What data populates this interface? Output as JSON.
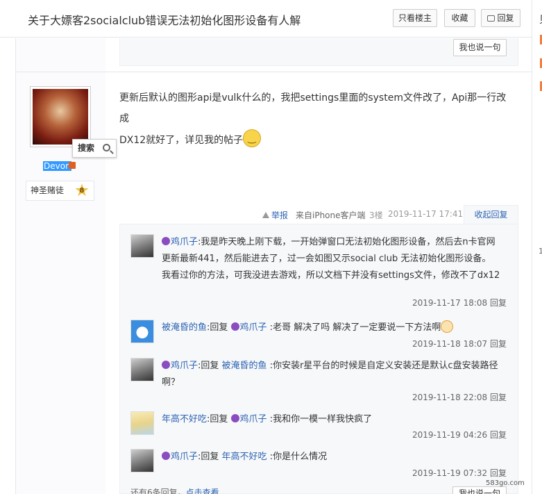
{
  "header": {
    "title": "关于大嫖客2socialclub错误无法初始化图形设备有人解",
    "only_op": "只看楼主",
    "favorite": "收藏",
    "reply": "回复"
  },
  "right_strip": {
    "char": "贝",
    "number": "1",
    "accent": "#f47c3c"
  },
  "previous_post": {
    "say_button": "我也说一句"
  },
  "user": {
    "name": "Devon",
    "rank_title": "神圣赌徒",
    "level": "8",
    "search_tooltip": "搜索"
  },
  "post": {
    "text_line1": "更新后默认的图形api是vulk什么的，我把settings里面的system文件改了，Api那一行改成",
    "text_line2": "DX12就好了，详见我的帖子",
    "report": "举报",
    "client": "来自iPhone客户端",
    "floor": "3楼",
    "time": "2019-11-17 17:41",
    "collapse": "收起回复"
  },
  "comments": [
    {
      "user": "鸡爪子",
      "text": ":我是昨天晚上刚下载，一开始弹窗口无法初始化图形设备，然后去n卡官网更新最新441，然后能进去了，过一会如图又示social club 无法初始化图形设备。 我看过你的方法，可我没进去游戏，所以文档下并没有settings文件，修改不了dx12",
      "time": "2019-11-17 18:08",
      "reply": "回复"
    },
    {
      "user": "被淹昏的鱼",
      "prefix": ":回复",
      "target": "鸡爪子",
      "text": ":老哥 解决了吗 解决了一定要说一下方法啊",
      "time": "2019-11-18 18:07",
      "reply": "回复"
    },
    {
      "user": "鸡爪子",
      "prefix": ":回复",
      "target": "被淹昏的鱼",
      "text": ":你安装r星平台的时候是自定义安装还是默认c盘安装路径啊？",
      "time": "2019-11-18 22:08",
      "reply": "回复"
    },
    {
      "user": "年高不好吃",
      "prefix": ":回复",
      "target": "鸡爪子",
      "text": ":我和你一模一样我快疯了",
      "time": "2019-11-19 04:26",
      "reply": "回复"
    },
    {
      "user": "鸡爪子",
      "prefix": ":回复",
      "target": "年高不好吃",
      "text": ":你是什么情况",
      "time": "2019-11-19 07:32",
      "reply": "回复"
    }
  ],
  "footer": {
    "more": "还有6条回复，",
    "more_link": "点击查看",
    "say_button": "我也说一句"
  },
  "watermark": "583go.com"
}
